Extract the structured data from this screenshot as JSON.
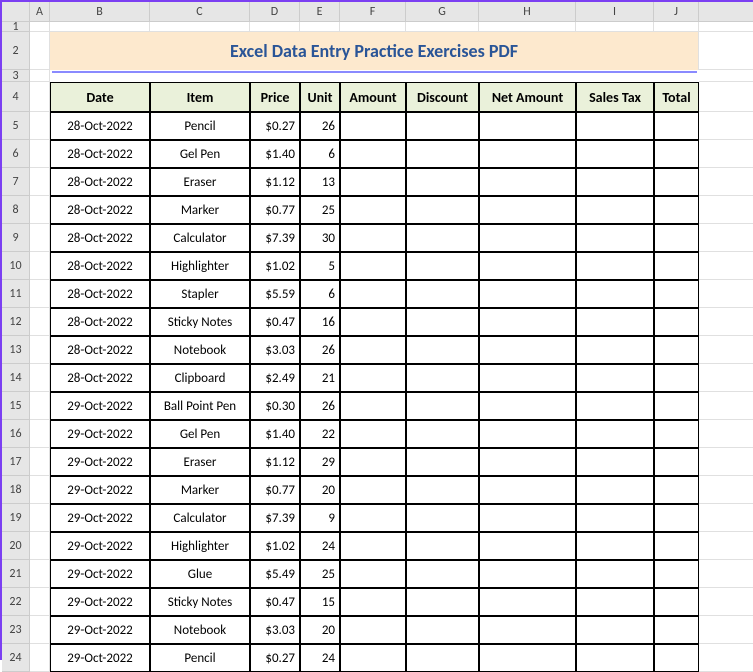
{
  "columns": [
    "A",
    "B",
    "C",
    "D",
    "E",
    "F",
    "G",
    "H",
    "I",
    "J"
  ],
  "row_numbers": [
    1,
    2,
    3,
    4,
    5,
    6,
    7,
    8,
    9,
    10,
    11,
    12,
    13,
    14,
    15,
    16,
    17,
    18,
    19,
    20,
    21,
    22,
    23,
    24
  ],
  "title": "Excel Data Entry Practice Exercises PDF",
  "headers": {
    "date": "Date",
    "item": "Item",
    "price": "Price",
    "unit": "Unit",
    "amount": "Amount",
    "discount": "Discount",
    "net_amount": "Net Amount",
    "sales_tax": "Sales Tax",
    "total": "Total"
  },
  "chart_data": {
    "type": "table",
    "title": "Excel Data Entry Practice Exercises PDF",
    "columns": [
      "Date",
      "Item",
      "Price",
      "Unit",
      "Amount",
      "Discount",
      "Net Amount",
      "Sales Tax",
      "Total"
    ],
    "rows": [
      {
        "date": "28-Oct-2022",
        "item": "Pencil",
        "price": "$0.27",
        "unit": "26",
        "amount": "",
        "discount": "",
        "net_amount": "",
        "sales_tax": "",
        "total": ""
      },
      {
        "date": "28-Oct-2022",
        "item": "Gel Pen",
        "price": "$1.40",
        "unit": "6",
        "amount": "",
        "discount": "",
        "net_amount": "",
        "sales_tax": "",
        "total": ""
      },
      {
        "date": "28-Oct-2022",
        "item": "Eraser",
        "price": "$1.12",
        "unit": "13",
        "amount": "",
        "discount": "",
        "net_amount": "",
        "sales_tax": "",
        "total": ""
      },
      {
        "date": "28-Oct-2022",
        "item": "Marker",
        "price": "$0.77",
        "unit": "25",
        "amount": "",
        "discount": "",
        "net_amount": "",
        "sales_tax": "",
        "total": ""
      },
      {
        "date": "28-Oct-2022",
        "item": "Calculator",
        "price": "$7.39",
        "unit": "30",
        "amount": "",
        "discount": "",
        "net_amount": "",
        "sales_tax": "",
        "total": ""
      },
      {
        "date": "28-Oct-2022",
        "item": "Highlighter",
        "price": "$1.02",
        "unit": "5",
        "amount": "",
        "discount": "",
        "net_amount": "",
        "sales_tax": "",
        "total": ""
      },
      {
        "date": "28-Oct-2022",
        "item": "Stapler",
        "price": "$5.59",
        "unit": "6",
        "amount": "",
        "discount": "",
        "net_amount": "",
        "sales_tax": "",
        "total": ""
      },
      {
        "date": "28-Oct-2022",
        "item": "Sticky Notes",
        "price": "$0.47",
        "unit": "16",
        "amount": "",
        "discount": "",
        "net_amount": "",
        "sales_tax": "",
        "total": ""
      },
      {
        "date": "28-Oct-2022",
        "item": "Notebook",
        "price": "$3.03",
        "unit": "26",
        "amount": "",
        "discount": "",
        "net_amount": "",
        "sales_tax": "",
        "total": ""
      },
      {
        "date": "28-Oct-2022",
        "item": "Clipboard",
        "price": "$2.49",
        "unit": "21",
        "amount": "",
        "discount": "",
        "net_amount": "",
        "sales_tax": "",
        "total": ""
      },
      {
        "date": "29-Oct-2022",
        "item": "Ball Point Pen",
        "price": "$0.30",
        "unit": "26",
        "amount": "",
        "discount": "",
        "net_amount": "",
        "sales_tax": "",
        "total": ""
      },
      {
        "date": "29-Oct-2022",
        "item": "Gel Pen",
        "price": "$1.40",
        "unit": "22",
        "amount": "",
        "discount": "",
        "net_amount": "",
        "sales_tax": "",
        "total": ""
      },
      {
        "date": "29-Oct-2022",
        "item": "Eraser",
        "price": "$1.12",
        "unit": "29",
        "amount": "",
        "discount": "",
        "net_amount": "",
        "sales_tax": "",
        "total": ""
      },
      {
        "date": "29-Oct-2022",
        "item": "Marker",
        "price": "$0.77",
        "unit": "20",
        "amount": "",
        "discount": "",
        "net_amount": "",
        "sales_tax": "",
        "total": ""
      },
      {
        "date": "29-Oct-2022",
        "item": "Calculator",
        "price": "$7.39",
        "unit": "9",
        "amount": "",
        "discount": "",
        "net_amount": "",
        "sales_tax": "",
        "total": ""
      },
      {
        "date": "29-Oct-2022",
        "item": "Highlighter",
        "price": "$1.02",
        "unit": "24",
        "amount": "",
        "discount": "",
        "net_amount": "",
        "sales_tax": "",
        "total": ""
      },
      {
        "date": "29-Oct-2022",
        "item": "Glue",
        "price": "$5.49",
        "unit": "25",
        "amount": "",
        "discount": "",
        "net_amount": "",
        "sales_tax": "",
        "total": ""
      },
      {
        "date": "29-Oct-2022",
        "item": "Sticky Notes",
        "price": "$0.47",
        "unit": "15",
        "amount": "",
        "discount": "",
        "net_amount": "",
        "sales_tax": "",
        "total": ""
      },
      {
        "date": "29-Oct-2022",
        "item": "Notebook",
        "price": "$3.03",
        "unit": "20",
        "amount": "",
        "discount": "",
        "net_amount": "",
        "sales_tax": "",
        "total": ""
      },
      {
        "date": "29-Oct-2022",
        "item": "Pencil",
        "price": "$0.27",
        "unit": "24",
        "amount": "",
        "discount": "",
        "net_amount": "",
        "sales_tax": "",
        "total": ""
      }
    ]
  }
}
